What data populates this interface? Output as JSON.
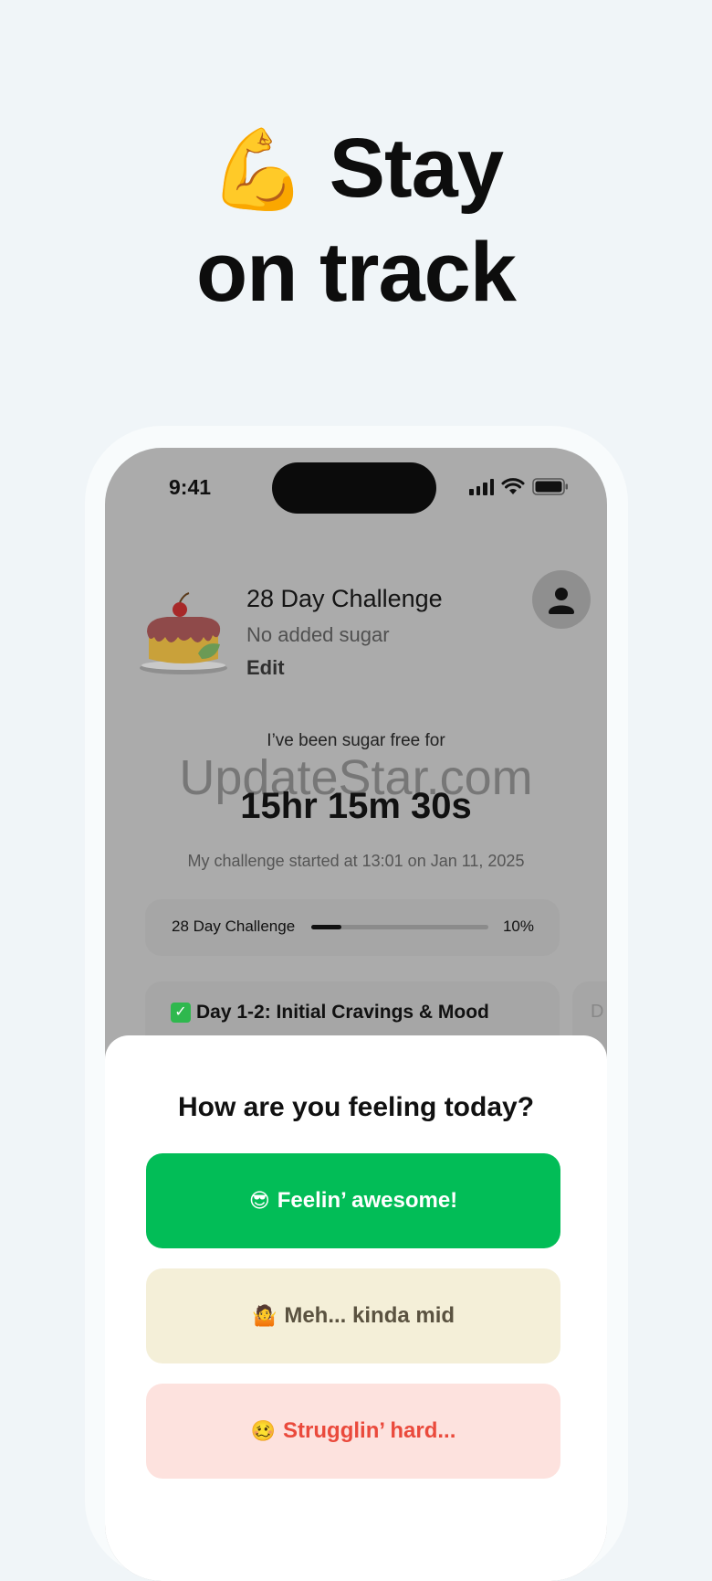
{
  "headline": {
    "emoji": "💪",
    "line1": "Stay",
    "line2": "on track"
  },
  "status_bar": {
    "time": "9:41"
  },
  "challenge": {
    "title": "28 Day Challenge",
    "subtitle": "No added sugar",
    "edit_label": "Edit"
  },
  "tracker": {
    "label": "I’ve been sugar free for",
    "duration": "15hr 15m 30s",
    "started_text": "My challenge started at 13:01 on Jan 11, 2025"
  },
  "watermark": "UpdateStar.com",
  "progress": {
    "label": "28 Day Challenge",
    "percent_text": "10%",
    "fraction": 0.17
  },
  "day_card": {
    "check": "✓",
    "title": "Day 1-2: Initial Cravings & Mood",
    "next_peek": "D"
  },
  "mood_sheet": {
    "title": "How are you feeling today?",
    "options": [
      {
        "emoji": "😎",
        "label": "Feelin’ awesome!"
      },
      {
        "emoji": "🤷",
        "label": "Meh... kinda mid"
      },
      {
        "emoji": "🥴",
        "label": "Strugglin’ hard..."
      }
    ]
  },
  "colors": {
    "page_bg": "#f0f5f8",
    "screen_dim": "#ababab",
    "great": "#02bd57",
    "mid": "#f4efd8",
    "bad": "#fde2de",
    "bad_text": "#ea4a3c"
  },
  "icons": [
    "flexed-biceps-emoji",
    "signal-icon",
    "wifi-icon",
    "battery-icon",
    "person-icon",
    "cake-illustration",
    "check-icon"
  ]
}
